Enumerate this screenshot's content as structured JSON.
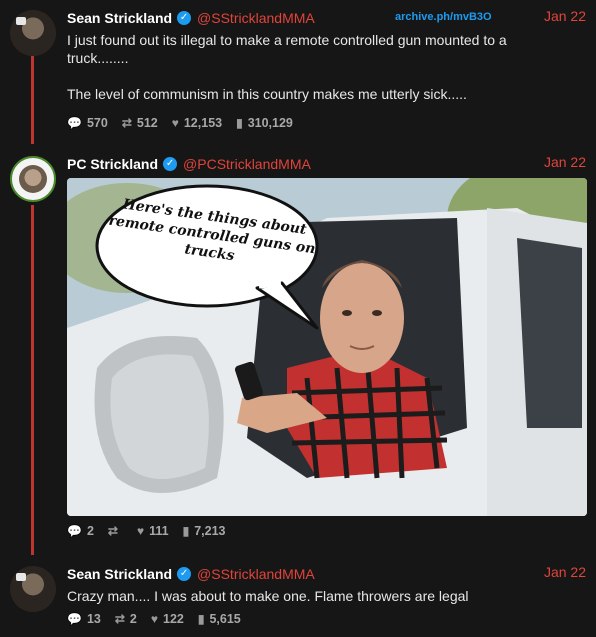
{
  "archive_link": "archive.ph/mvB3O",
  "tweets": [
    {
      "name": "Sean Strickland",
      "handle": "@SStricklandMMA",
      "date": "Jan 22",
      "text": "I just found out its illegal to make a remote controlled gun mounted to a truck........\n\nThe level of communism in this country makes me utterly sick.....",
      "replies": "570",
      "retweets": "512",
      "likes": "12,153",
      "views": "310,129"
    },
    {
      "name": "PC Strickland",
      "handle": "@PCStricklandMMA",
      "date": "Jan 22",
      "image_caption": "Here's the things about remote controlled guns on trucks",
      "replies": "2",
      "retweets": "",
      "likes": "111",
      "views": "7,213"
    },
    {
      "name": "Sean Strickland",
      "handle": "@SStricklandMMA",
      "date": "Jan 22",
      "text": "Crazy man....  I was about to make one. Flame throwers are legal",
      "replies": "13",
      "retweets": "2",
      "likes": "122",
      "views": "5,615"
    }
  ],
  "icons": {
    "reply": "speech-bubble-icon",
    "retweet": "retweet-icon",
    "like": "heart-icon",
    "views": "bar-chart-icon",
    "verified": "verified-check-icon"
  },
  "colors": {
    "background": "#161616",
    "handle": "#e0443b",
    "thread": "#c0342f",
    "verified": "#1d9bf0"
  }
}
